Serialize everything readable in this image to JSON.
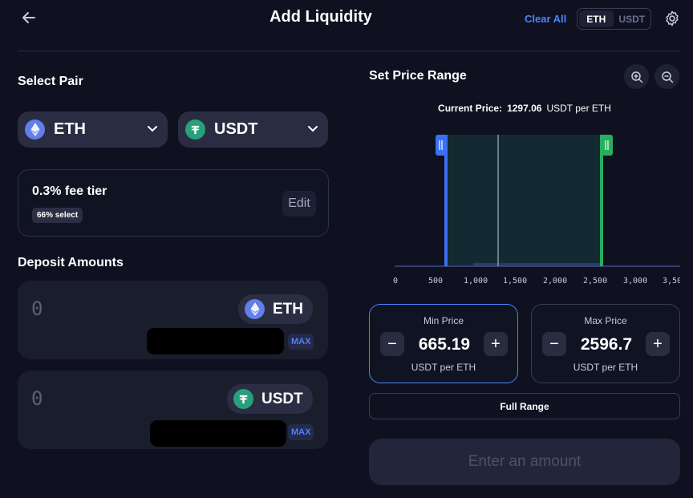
{
  "header": {
    "title": "Add Liquidity",
    "clear_all": "Clear All",
    "toggle": [
      "ETH",
      "USDT"
    ]
  },
  "left": {
    "select_pair_title": "Select Pair",
    "token_a": "ETH",
    "token_b": "USDT",
    "fee": {
      "label": "0.3% fee tier",
      "badge": "66% select",
      "edit": "Edit"
    },
    "deposit_title": "Deposit Amounts",
    "deposits": [
      {
        "value": "0",
        "token": "ETH",
        "max": "MAX"
      },
      {
        "value": "0",
        "token": "USDT",
        "max": "MAX"
      }
    ]
  },
  "right": {
    "price_range_title": "Set Price Range",
    "current_price_label": "Current Price:",
    "current_price_value": "1297.06",
    "current_price_unit": "USDT per ETH",
    "axis_ticks": [
      "0",
      "500",
      "1,000",
      "1,500",
      "2,000",
      "2,500",
      "3,000",
      "3,50"
    ],
    "min": {
      "title": "Min Price",
      "value": "665.19",
      "unit": "USDT per ETH"
    },
    "max": {
      "title": "Max Price",
      "value": "2596.7",
      "unit": "USDT per ETH"
    },
    "full_range": "Full Range",
    "enter_amount": "Enter an amount"
  },
  "colors": {
    "accent": "#4c82fb",
    "min_handle": "#3b6ff5",
    "max_handle": "#27ae60",
    "eth": "#627eea",
    "usdt": "#26a17b"
  }
}
